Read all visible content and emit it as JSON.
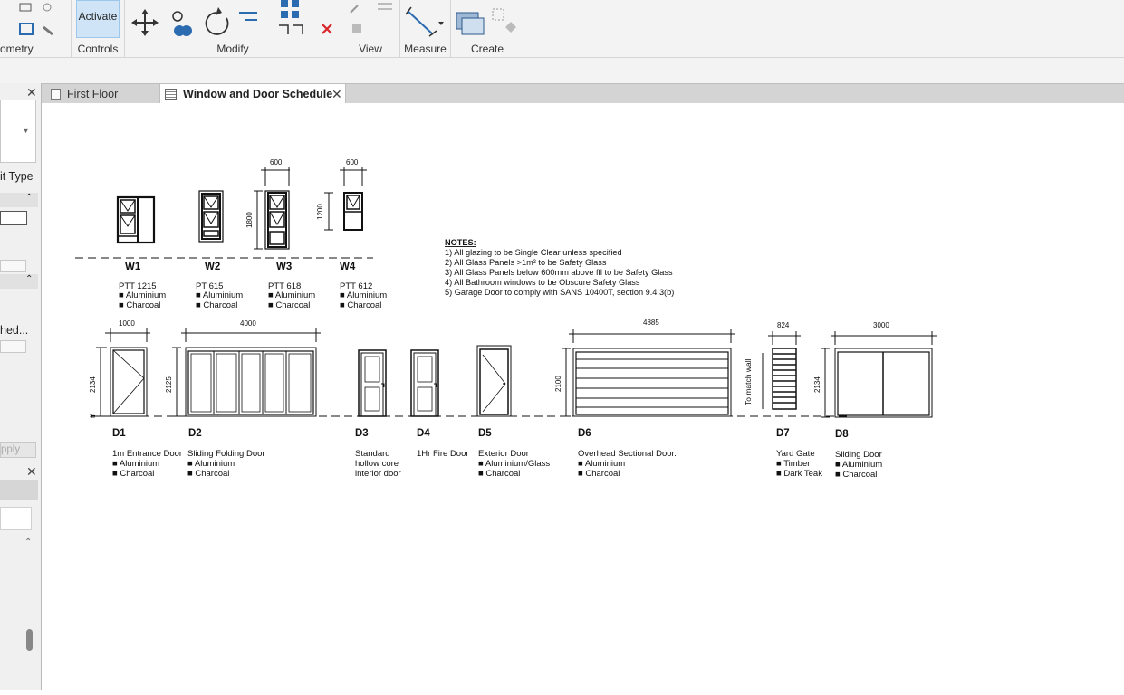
{
  "ribbon": {
    "groups": [
      {
        "label": "ometry"
      },
      {
        "label": "Controls"
      },
      {
        "label": "Modify"
      },
      {
        "label": "View"
      },
      {
        "label": "Measure"
      },
      {
        "label": "Create"
      }
    ],
    "activate_label": "Activate"
  },
  "tabs": [
    {
      "label": "First Floor",
      "active": false
    },
    {
      "label": "Window and Door Schedule",
      "active": true
    }
  ],
  "left_panel": {
    "type_label": "it Type",
    "field_label": "hed...",
    "apply_label": "pply"
  },
  "icons": {
    "move": "move-icon",
    "rotate": "rotate-icon",
    "delete": "delete-x-icon",
    "measure": "measure-icon",
    "create": "create-group-icon",
    "schedule": "schedule-icon",
    "floorplan": "floor-plan-icon"
  },
  "colors": {
    "delete": "#d9262b",
    "activate_bg": "#cfe5f7"
  },
  "drawing": {
    "notes": {
      "title": "NOTES:",
      "lines": [
        "1) All glazing to be Single Clear unless specified",
        "2) All Glass Panels >1m² to be Safety Glass",
        "3) All Glass Panels below 600mm above ffl to be Safety Glass",
        "4) All Bathroom windows to be Obscure Safety Glass",
        "5) Garage Door to comply with SANS 10400T, section 9.4.3(b)"
      ]
    },
    "windows": [
      {
        "tag": "W1",
        "lines": [
          "PTT 1215",
          "■ Aluminium",
          "■ Charcoal"
        ]
      },
      {
        "tag": "W2",
        "lines": [
          "PT 615",
          "■ Aluminium",
          "■ Charcoal"
        ]
      },
      {
        "tag": "W3",
        "lines": [
          "PTT 618",
          "■ Aluminium",
          "■ Charcoal"
        ]
      },
      {
        "tag": "W4",
        "lines": [
          "PTT 612",
          "■ Aluminium",
          "■ Charcoal"
        ]
      }
    ],
    "window_dims": {
      "w3_width": "600",
      "w3_height": "1800",
      "w4_width": "600",
      "w4_height": "1200"
    },
    "doors": [
      {
        "tag": "D1",
        "lines": [
          "1m Entrance Door",
          "■ Aluminium",
          "■ Charcoal"
        ]
      },
      {
        "tag": "D2",
        "lines": [
          "Sliding Folding Door",
          "■ Aluminium",
          "■ Charcoal"
        ]
      },
      {
        "tag": "D3",
        "lines": [
          "Standard",
          "hollow core",
          "interior door"
        ]
      },
      {
        "tag": "D4",
        "lines": [
          "1Hr Fire Door"
        ]
      },
      {
        "tag": "D5",
        "lines": [
          "Exterior Door",
          "■ Aluminium/Glass",
          "■ Charcoal"
        ]
      },
      {
        "tag": "D6",
        "lines": [
          "Overhead Sectional Door.",
          "■ Aluminium",
          "■ Charcoal"
        ]
      },
      {
        "tag": "D7",
        "lines": [
          "Yard Gate",
          "■ Timber",
          "■ Dark Teak"
        ]
      },
      {
        "tag": "D8",
        "lines": [
          "Sliding Door",
          "■ Aluminium",
          "■ Charcoal"
        ]
      }
    ],
    "door_dims": {
      "d1_width": "1000",
      "d1_height": "2134",
      "d1_ffl": "ffl",
      "d2_width": "4000",
      "d2_height": "2125",
      "d6_width": "4885",
      "d6_height": "2100",
      "d6_side": "To match wall",
      "d7_width": "824",
      "d8_width": "3000",
      "d8_height": "2134"
    }
  }
}
